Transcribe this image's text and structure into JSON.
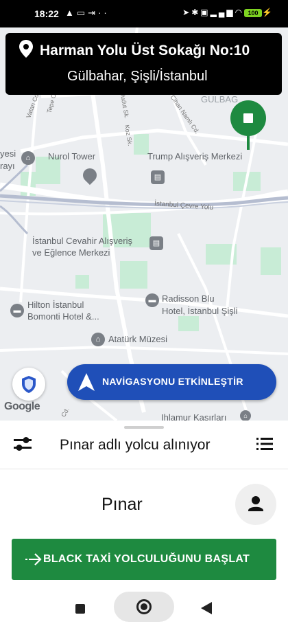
{
  "status_bar": {
    "time": "18:22",
    "left_icons": [
      "navigation-icon",
      "notification-icon",
      "download-icon",
      "more-icon"
    ],
    "right_icons": [
      "location-icon",
      "bluetooth-icon",
      "vibrate-icon",
      "signal-icon",
      "wifi-icon"
    ],
    "battery": "100"
  },
  "address": {
    "line1": "Harman Yolu Üst Sokağı No:10",
    "line2": "Gülbahar, Şişli/İstanbul"
  },
  "map": {
    "labels": {
      "gulbag": "GULBAG",
      "yesi": "yesi",
      "rayi": "rayı",
      "nurol": "Nurol Tower",
      "trump": "Trump Alışveriş Merkezi",
      "cevre_yolu": "İstanbul Çevre Yolu",
      "cevahir1": "İstanbul Cevahir Alışveriş",
      "cevahir2": "ve Eğlence Merkezi",
      "radisson1": "Radisson Blu",
      "radisson2": "Hotel, İstanbul Şişli",
      "hilton1": "Hilton İstanbul",
      "hilton2": "Bomonti Hotel &...",
      "ataturk": "Atatürk Müzesi",
      "ihlamur": "Ihlamur Kasırları",
      "vatan": "Vatan Cd.",
      "tepe": "Tepe Cd.",
      "hudut": "Hudut Sk.",
      "koz": "Koz Sk.",
      "cihan": "Ef Cihan Namlı Cd.",
      "cd": "Cd."
    },
    "google_logo": "Google",
    "accent": "#1e8a40"
  },
  "navigation_button": {
    "label": "NAVİGASYONU ETKİNLEŞTİR",
    "color": "#1f4fb8"
  },
  "sheet": {
    "status_title": "Pınar adlı yolcu alınıyor",
    "rider_name": "Pınar",
    "start_button": "BLACK TAXİ YOLCULUĞUNU BAŞLAT",
    "start_button_color": "#1e8a40"
  },
  "system_nav": {
    "buttons": [
      "recents-button",
      "home-button",
      "back-button"
    ]
  }
}
